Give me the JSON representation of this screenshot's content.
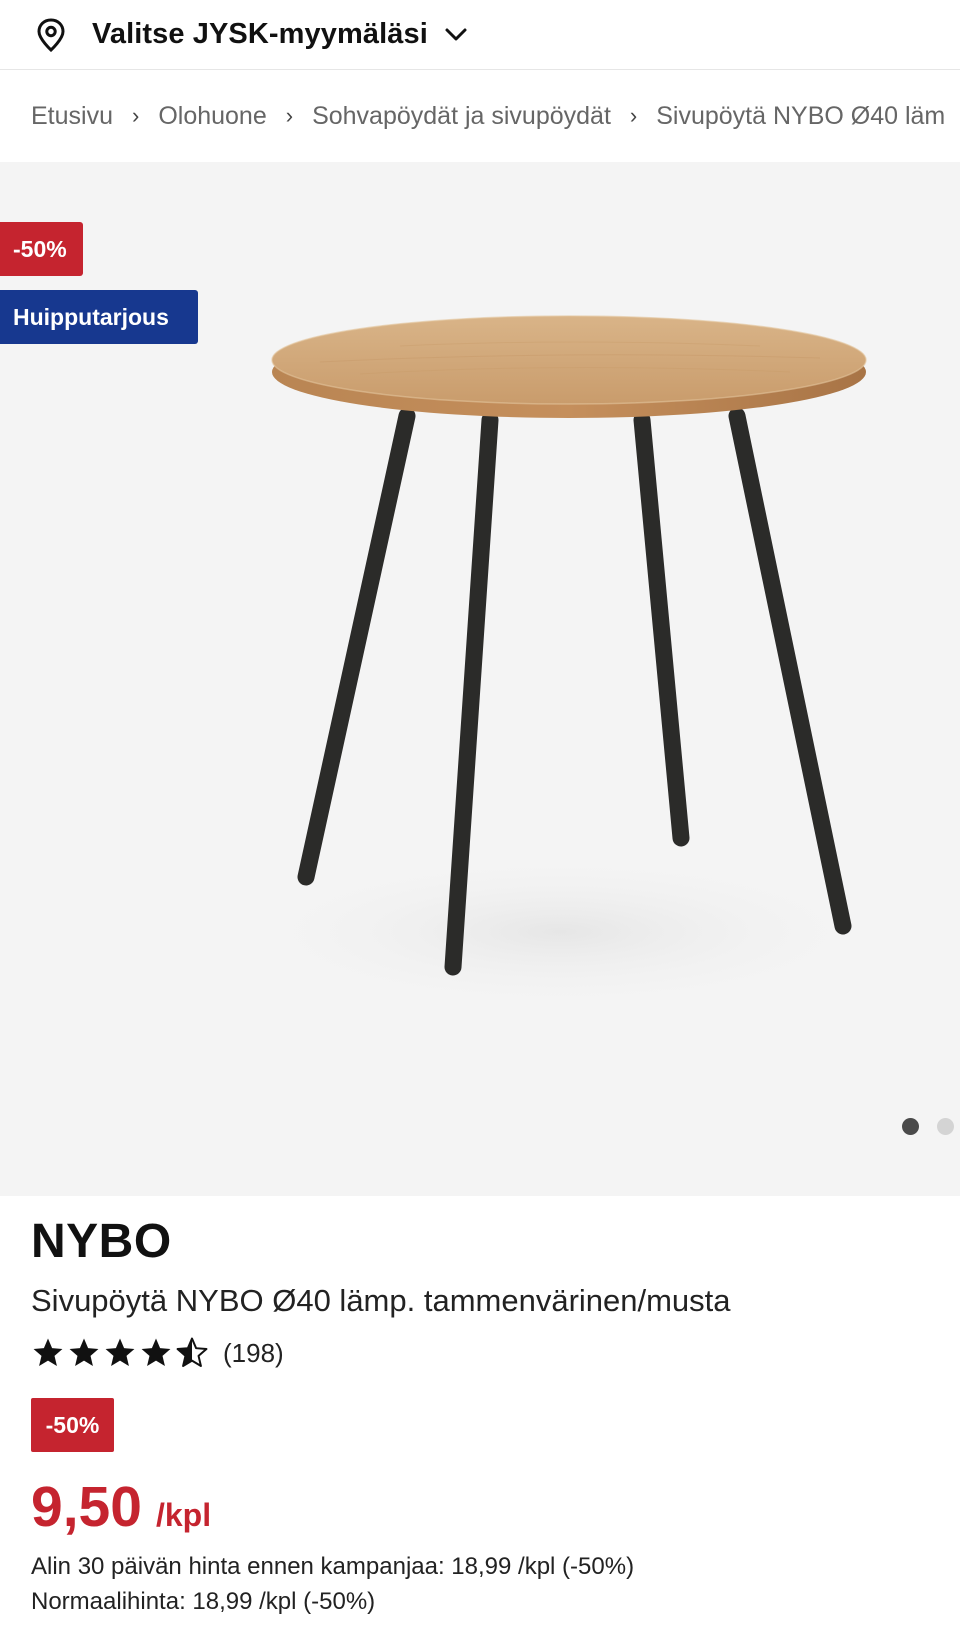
{
  "store_bar": {
    "label": "Valitse JYSK-myymäläsi",
    "icons": [
      "location-pin-icon",
      "chevron-down-icon"
    ]
  },
  "breadcrumb": {
    "items": [
      "Etusivu",
      "Olohuone",
      "Sohvapöydät ja sivupöydät",
      "Sivupöytä NYBO Ø40 läm"
    ],
    "separator": "›"
  },
  "gallery": {
    "badges": {
      "discount": "-50%",
      "deal": "Huipputarjous"
    },
    "dots": 2,
    "active_dot": 1
  },
  "product": {
    "brand": "NYBO",
    "name": "Sivupöytä NYBO Ø40 lämp. tammenvärinen/musta",
    "rating": 4.5,
    "rating_count": "(198)",
    "discount_badge": "-50%",
    "price": "9,50",
    "unit": "/kpl",
    "lowest_price_note": "Alin 30 päivän hinta ennen kampanjaa: 18,99 /kpl (-50%)",
    "normal_price_note": "Normaalihinta: 18,99 /kpl (-50%)"
  },
  "colors": {
    "discount_red": "#c5242f",
    "deal_blue": "#17388f",
    "gallery_bg": "#f4f4f4"
  }
}
